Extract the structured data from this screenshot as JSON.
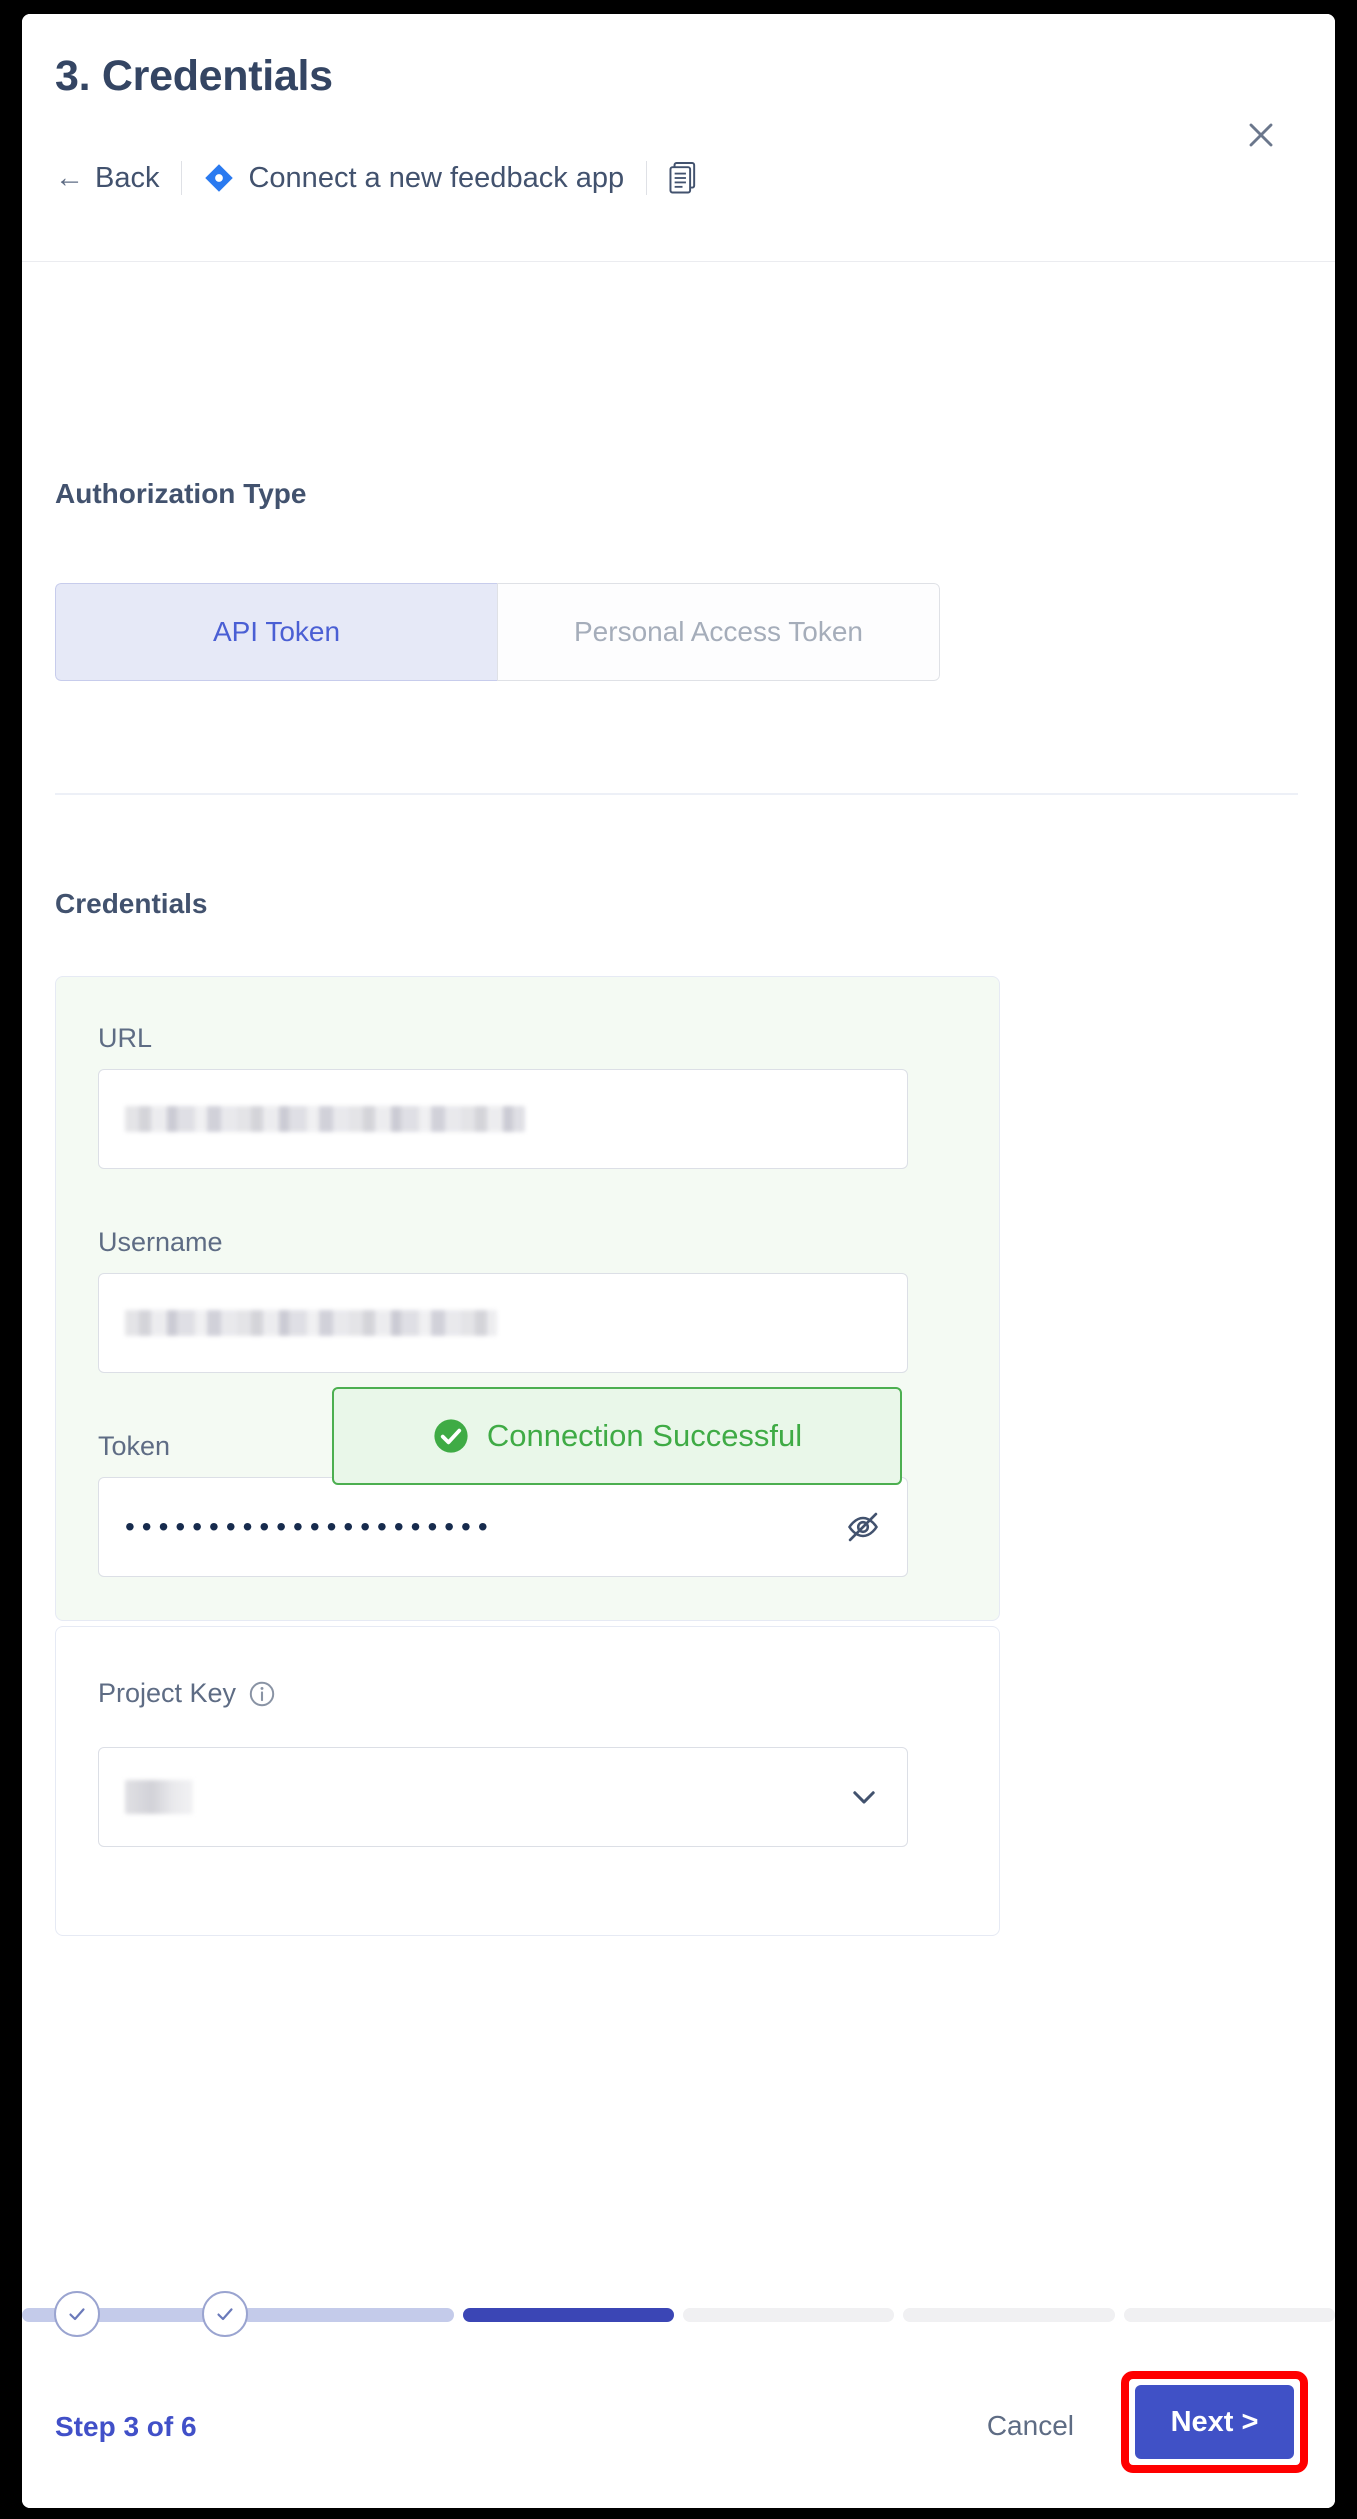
{
  "dialog": {
    "title": "3. Credentials",
    "back_label": "Back",
    "back_arrow": "←",
    "app_label": "Connect a new feedback app",
    "app_icon": "jira-diamond-icon",
    "doc_icon": "copy-document-icon",
    "close_icon": "close-icon"
  },
  "auth": {
    "section_title": "Authorization Type",
    "options": [
      {
        "label": "API Token",
        "selected": true
      },
      {
        "label": "Personal Access Token",
        "selected": false
      }
    ]
  },
  "credentials": {
    "section_title": "Credentials",
    "fields": [
      {
        "label": "URL",
        "value": "",
        "redacted": true,
        "type": "text"
      },
      {
        "label": "Username",
        "value": "",
        "redacted": true,
        "type": "text"
      },
      {
        "label": "Token",
        "value": "••••••••••••••••••••••",
        "redacted": false,
        "type": "password",
        "toggle_icon": "eye-off-icon"
      }
    ],
    "connection_status": {
      "label": "Connection Successful",
      "icon": "check-circle-icon",
      "color": "#3fab45",
      "background": "#e9f7e9",
      "border": "#4caf50"
    }
  },
  "project_key": {
    "label": "Project Key",
    "info_icon": "info-icon",
    "value": "",
    "redacted": true,
    "chevron_icon": "chevron-down-icon"
  },
  "footer": {
    "step_label": "Step 3 of 6",
    "cancel_label": "Cancel",
    "next_label": "Next >",
    "current_step": 3,
    "total_steps": 6,
    "segments": [
      "done",
      "done",
      "active",
      "todo",
      "todo",
      "todo"
    ],
    "colors": {
      "done": "#c4cbea",
      "active": "#3b46b5",
      "todo": "#f0f0f2",
      "next_button": "#4051c6",
      "step_label": "#4150c8",
      "highlight": "#ff0000"
    }
  }
}
